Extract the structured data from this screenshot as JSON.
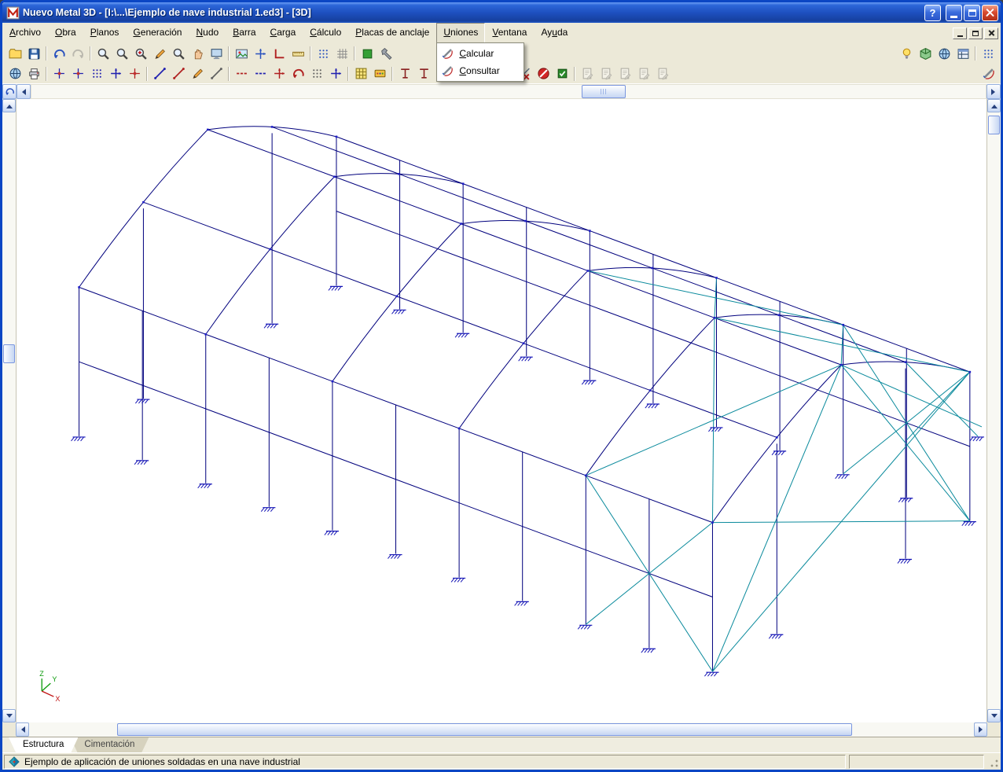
{
  "window": {
    "title": "Nuevo Metal 3D - [I:\\...\\Ejemplo de nave industrial 1.ed3] - [3D]",
    "help_glyph": "?"
  },
  "menubar": {
    "items": [
      {
        "label": "Archivo",
        "accel": 0
      },
      {
        "label": "Obra",
        "accel": 0
      },
      {
        "label": "Planos",
        "accel": 0
      },
      {
        "label": "Generación",
        "accel": 0
      },
      {
        "label": "Nudo",
        "accel": 0
      },
      {
        "label": "Barra",
        "accel": 0
      },
      {
        "label": "Carga",
        "accel": 0
      },
      {
        "label": "Cálculo",
        "accel": 0
      },
      {
        "label": "Placas de anclaje",
        "accel": 0
      },
      {
        "label": "Uniones",
        "accel": 0,
        "open": true
      },
      {
        "label": "Ventana",
        "accel": 0
      },
      {
        "label": "Ayuda",
        "accel": 2
      }
    ]
  },
  "uniones_menu": {
    "items": [
      {
        "label": "Calcular",
        "accel": 0,
        "icon": "weld"
      },
      {
        "label": "Consultar",
        "accel": 0,
        "icon": "weld"
      }
    ]
  },
  "toolbar_row1": [
    {
      "name": "open-button",
      "icon": "folder"
    },
    {
      "name": "save-button",
      "icon": "disk"
    },
    {
      "sep": true
    },
    {
      "name": "undo-button",
      "icon": "undo",
      "color": "#2A52BE"
    },
    {
      "name": "redo-button",
      "icon": "redo",
      "color": "#707070",
      "disabled": true
    },
    {
      "sep": true
    },
    {
      "name": "zoom-search-button",
      "icon": "mag",
      "color": "#444444"
    },
    {
      "name": "zoom-extents-button",
      "icon": "mag",
      "color": "#444444"
    },
    {
      "name": "zoom-window-button",
      "icon": "magplus",
      "color": "#444444"
    },
    {
      "name": "redraw-button",
      "icon": "pencil"
    },
    {
      "name": "zoom-previous-button",
      "icon": "mag",
      "color": "#444444"
    },
    {
      "name": "pan-button",
      "icon": "hand"
    },
    {
      "name": "screen-capture-button",
      "icon": "monitor"
    },
    {
      "sep": true
    },
    {
      "name": "image-export-button",
      "icon": "picture"
    },
    {
      "name": "move-label-button",
      "icon": "axiscross",
      "color": "#2A52BE"
    },
    {
      "name": "ortho-mode-button",
      "icon": "angle",
      "color": "#B02020"
    },
    {
      "name": "measure-button",
      "icon": "ruler"
    },
    {
      "sep": true
    },
    {
      "name": "snap-points-button",
      "icon": "dotgrid",
      "color": "#2A52BE"
    },
    {
      "name": "grid-button",
      "icon": "gridlines",
      "color": "#8A8A8A"
    },
    {
      "sep": true
    },
    {
      "name": "layer-visibility-button",
      "icon": "greensq"
    },
    {
      "name": "tools-button",
      "icon": "hammer"
    },
    {
      "spacer": true
    },
    {
      "name": "light-render-button",
      "icon": "bulb"
    },
    {
      "name": "view-3d-button",
      "icon": "cube"
    },
    {
      "name": "shading-button",
      "icon": "globe"
    },
    {
      "name": "window-panel-button",
      "icon": "panel"
    },
    {
      "sep": true
    },
    {
      "name": "dock-config-button",
      "icon": "dotgrid",
      "color": "#2A52BE"
    }
  ],
  "toolbar_row2": [
    {
      "name": "project-data-button",
      "icon": "globe"
    },
    {
      "name": "print-button",
      "icon": "printer"
    },
    {
      "sep": true
    },
    {
      "name": "node-new-button",
      "icon": "nodecross",
      "color": "#2020B0"
    },
    {
      "name": "node-move-button",
      "icon": "nodecross",
      "color": "#2020B0"
    },
    {
      "name": "node-mesh-button",
      "icon": "dotgrid",
      "color": "#2020B0"
    },
    {
      "name": "node-bind-button",
      "icon": "axiscross",
      "color": "#2020B0"
    },
    {
      "name": "node-delete-button",
      "icon": "nodecross",
      "color": "#B02020"
    },
    {
      "sep": true
    },
    {
      "name": "bar-new-button",
      "icon": "bardiag",
      "color": "#2020B0"
    },
    {
      "name": "bar-delete-button",
      "icon": "bardiag",
      "color": "#B02020"
    },
    {
      "name": "bar-describe-button",
      "icon": "pencil"
    },
    {
      "name": "bar-material-button",
      "icon": "bardiag",
      "color": "#606060"
    },
    {
      "sep": true
    },
    {
      "name": "bar-join-button",
      "icon": "dashes",
      "color": "#B02020"
    },
    {
      "name": "bar-split-button",
      "icon": "dashes",
      "color": "#2020B0"
    },
    {
      "name": "bar-axes-button",
      "icon": "axiscross",
      "color": "#B02020"
    },
    {
      "name": "bar-arc-button",
      "icon": "undo",
      "color": "#B02020"
    },
    {
      "name": "bar-dashed-button",
      "icon": "dotgrid",
      "color": "#606060"
    },
    {
      "name": "bar-cross-button",
      "icon": "axiscross",
      "color": "#2020B0"
    },
    {
      "sep": true
    },
    {
      "name": "generation-grid-button",
      "icon": "gridy"
    },
    {
      "name": "pallet-button",
      "icon": "palette"
    },
    {
      "sep": true
    },
    {
      "name": "buckling-button",
      "icon": "tee",
      "color": "#8A2020"
    },
    {
      "name": "buckling-group-button",
      "icon": "tee",
      "color": "#8A2020"
    },
    {
      "name": "deflection-limit-button",
      "icon": "tee",
      "color": "#2020B0"
    },
    {
      "sep": true
    },
    {
      "name": "weld-union-button",
      "icon": "weld"
    },
    {
      "name": "weld-query-button",
      "icon": "weld"
    },
    {
      "name": "check-bars-button",
      "icon": "chkok"
    },
    {
      "name": "check-errors-button",
      "icon": "chkbad"
    },
    {
      "name": "abort-button",
      "icon": "stop"
    },
    {
      "name": "results-button",
      "icon": "resok"
    },
    {
      "sep": true
    },
    {
      "name": "plate-edit-button",
      "icon": "docpen",
      "disabled": true
    },
    {
      "name": "plate-check-button",
      "icon": "docpen",
      "disabled": true
    },
    {
      "name": "plate-list-button",
      "icon": "docpen",
      "disabled": true
    },
    {
      "name": "plate-draw-button",
      "icon": "docpen",
      "disabled": true
    },
    {
      "name": "plate-export-button",
      "icon": "docpen",
      "disabled": true
    },
    {
      "spacer": true
    },
    {
      "name": "union-generate-button",
      "icon": "weld"
    }
  ],
  "tabs": [
    {
      "label": "Estructura",
      "active": true
    },
    {
      "label": "Cimentación",
      "active": false
    }
  ],
  "statusbar": {
    "text": "Ejemplo de aplicación de uniones soldadas en una nave industrial"
  },
  "axis_triad": {
    "x": "X",
    "y": "Y",
    "z": "Z"
  },
  "colors": {
    "structure": "#00007D",
    "bracing": "#0A8A9C",
    "supports": "#1616B6",
    "nodes": "#2020C8"
  }
}
